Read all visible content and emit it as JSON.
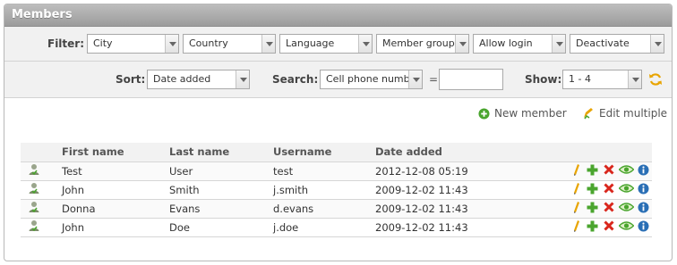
{
  "panel": {
    "title": "Members"
  },
  "filter": {
    "label": "Filter:",
    "selects": [
      {
        "value": "City"
      },
      {
        "value": "Country"
      },
      {
        "value": "Language"
      },
      {
        "value": "Member groups"
      },
      {
        "value": "Allow login"
      },
      {
        "value": "Deactivate"
      }
    ]
  },
  "sort": {
    "label": "Sort:",
    "value": "Date added"
  },
  "search": {
    "label": "Search:",
    "field": "Cell phone number",
    "operator": "=",
    "value": ""
  },
  "show": {
    "label": "Show:",
    "value": "1 - 4"
  },
  "actions": {
    "new_member": "New member",
    "edit_multiple": "Edit multiple"
  },
  "table": {
    "columns": [
      "First name",
      "Last name",
      "Username",
      "Date added"
    ],
    "rows": [
      {
        "first": "Test",
        "last": "User",
        "username": "test",
        "date": "2012-12-08 05:19"
      },
      {
        "first": "John",
        "last": "Smith",
        "username": "j.smith",
        "date": "2009-12-02 11:43"
      },
      {
        "first": "Donna",
        "last": "Evans",
        "username": "d.evans",
        "date": "2009-12-02 11:43"
      },
      {
        "first": "John",
        "last": "Doe",
        "username": "j.doe",
        "date": "2009-12-02 11:43"
      }
    ]
  },
  "icons": {
    "row_user": "user-icon",
    "row_actions": [
      "edit-pencil-icon",
      "add-plus-icon",
      "delete-x-icon",
      "view-eye-icon",
      "info-icon"
    ],
    "refresh": "refresh-icon",
    "new_member": "add-circle-icon",
    "edit_multiple": "edit-multiple-icon"
  },
  "colors": {
    "header": "#a8a8a8",
    "add": "#4aa52e",
    "delete": "#d9261c",
    "info": "#2a6fb5",
    "edit": "#e8a400"
  }
}
